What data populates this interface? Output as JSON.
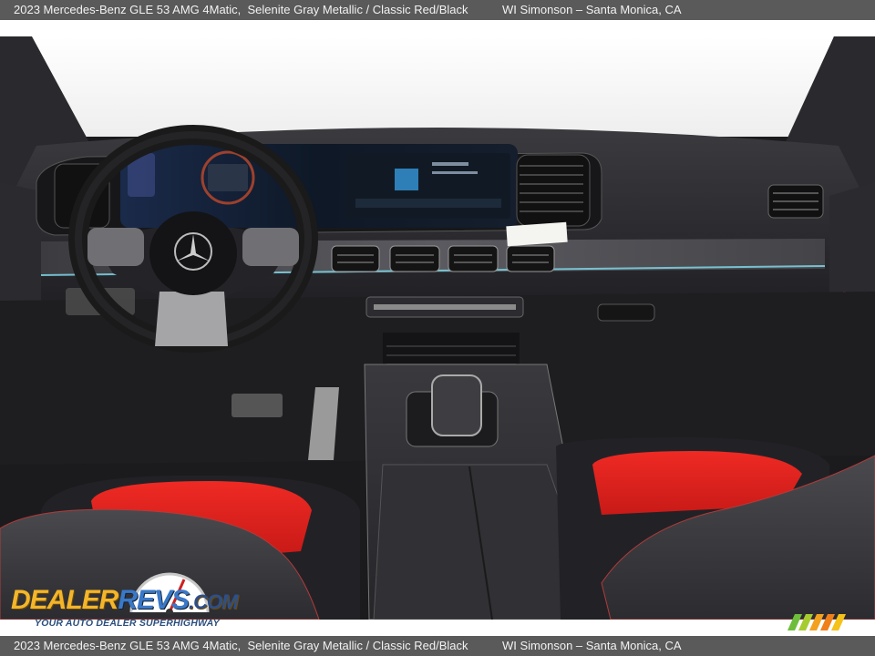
{
  "header": {
    "title": "2023 Mercedes-Benz GLE 53 AMG 4Matic,  Selenite Gray Metallic / Classic Red/Black",
    "dealer": "WI Simonson – Santa Monica, CA"
  },
  "footer": {
    "title": "2023 Mercedes-Benz GLE 53 AMG 4Matic,  Selenite Gray Metallic / Classic Red/Black",
    "dealer": "WI Simonson – Santa Monica, CA"
  },
  "watermark": {
    "brand_part1": "DEALER",
    "brand_part2": "REVS",
    "brand_part3": ".COM",
    "tagline": "YOUR AUTO DEALER SUPERHIGHWAY"
  },
  "colors": {
    "bar": "#5a5a5a",
    "seat_red": "#e0231f",
    "interior_dark": "#1b1b1d",
    "ambient_blue": "#7fd6e8"
  }
}
